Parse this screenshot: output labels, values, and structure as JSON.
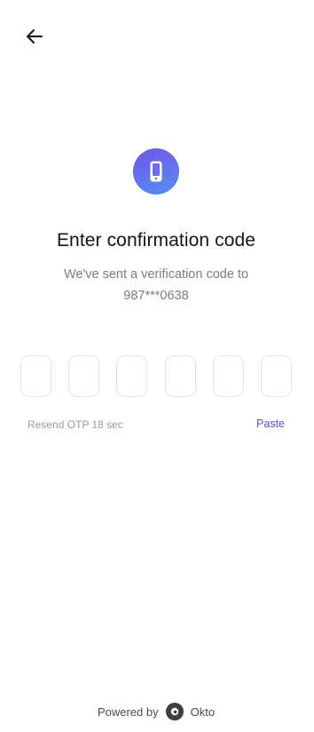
{
  "header": {
    "back_icon": "arrow-left-icon"
  },
  "hero": {
    "icon": "smartphone-icon",
    "accent_from": "#6d55e6",
    "accent_to": "#5a8ef4"
  },
  "content": {
    "title": "Enter confirmation code",
    "subtitle_line1": "We've sent a verification code to",
    "subtitle_line2": "987***0638"
  },
  "otp": {
    "length": 6,
    "digits": [
      "",
      "",
      "",
      "",
      "",
      ""
    ]
  },
  "actions": {
    "resend_text": "Resend OTP 18 sec",
    "paste_label": "Paste",
    "paste_color": "#5b4fc8"
  },
  "footer": {
    "powered_by": "Powered by",
    "brand_icon": "okto-logo-icon",
    "brand_name": "Okto"
  }
}
